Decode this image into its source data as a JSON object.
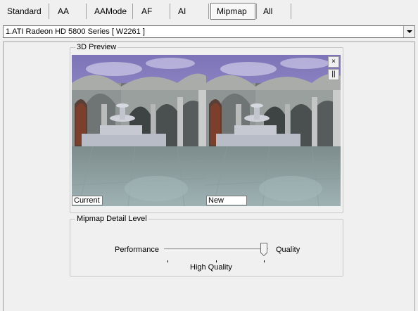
{
  "tabs": [
    {
      "label": "Standard",
      "active": false
    },
    {
      "label": "AA",
      "active": false
    },
    {
      "label": "AAMode",
      "active": false
    },
    {
      "label": "AF",
      "active": false
    },
    {
      "label": "AI",
      "active": false
    },
    {
      "label": "Mipmap",
      "active": true
    },
    {
      "label": "All",
      "active": false
    }
  ],
  "device": {
    "selected": "1.ATI Radeon HD 5800 Series [ W2261 ]"
  },
  "preview": {
    "title": "3D Preview",
    "current_label": "Current",
    "new_label": "New",
    "close_glyph": "×",
    "pause_glyph": "||"
  },
  "mipmap": {
    "title": "Mipmap Detail Level",
    "min_label": "Performance",
    "max_label": "Quality",
    "value_label": "High Quality",
    "tick_count": 3,
    "level_fraction": 1.0
  },
  "icons": {
    "dropdown": "chevron-down-icon",
    "close": "close-icon",
    "pause": "pause-icon"
  }
}
